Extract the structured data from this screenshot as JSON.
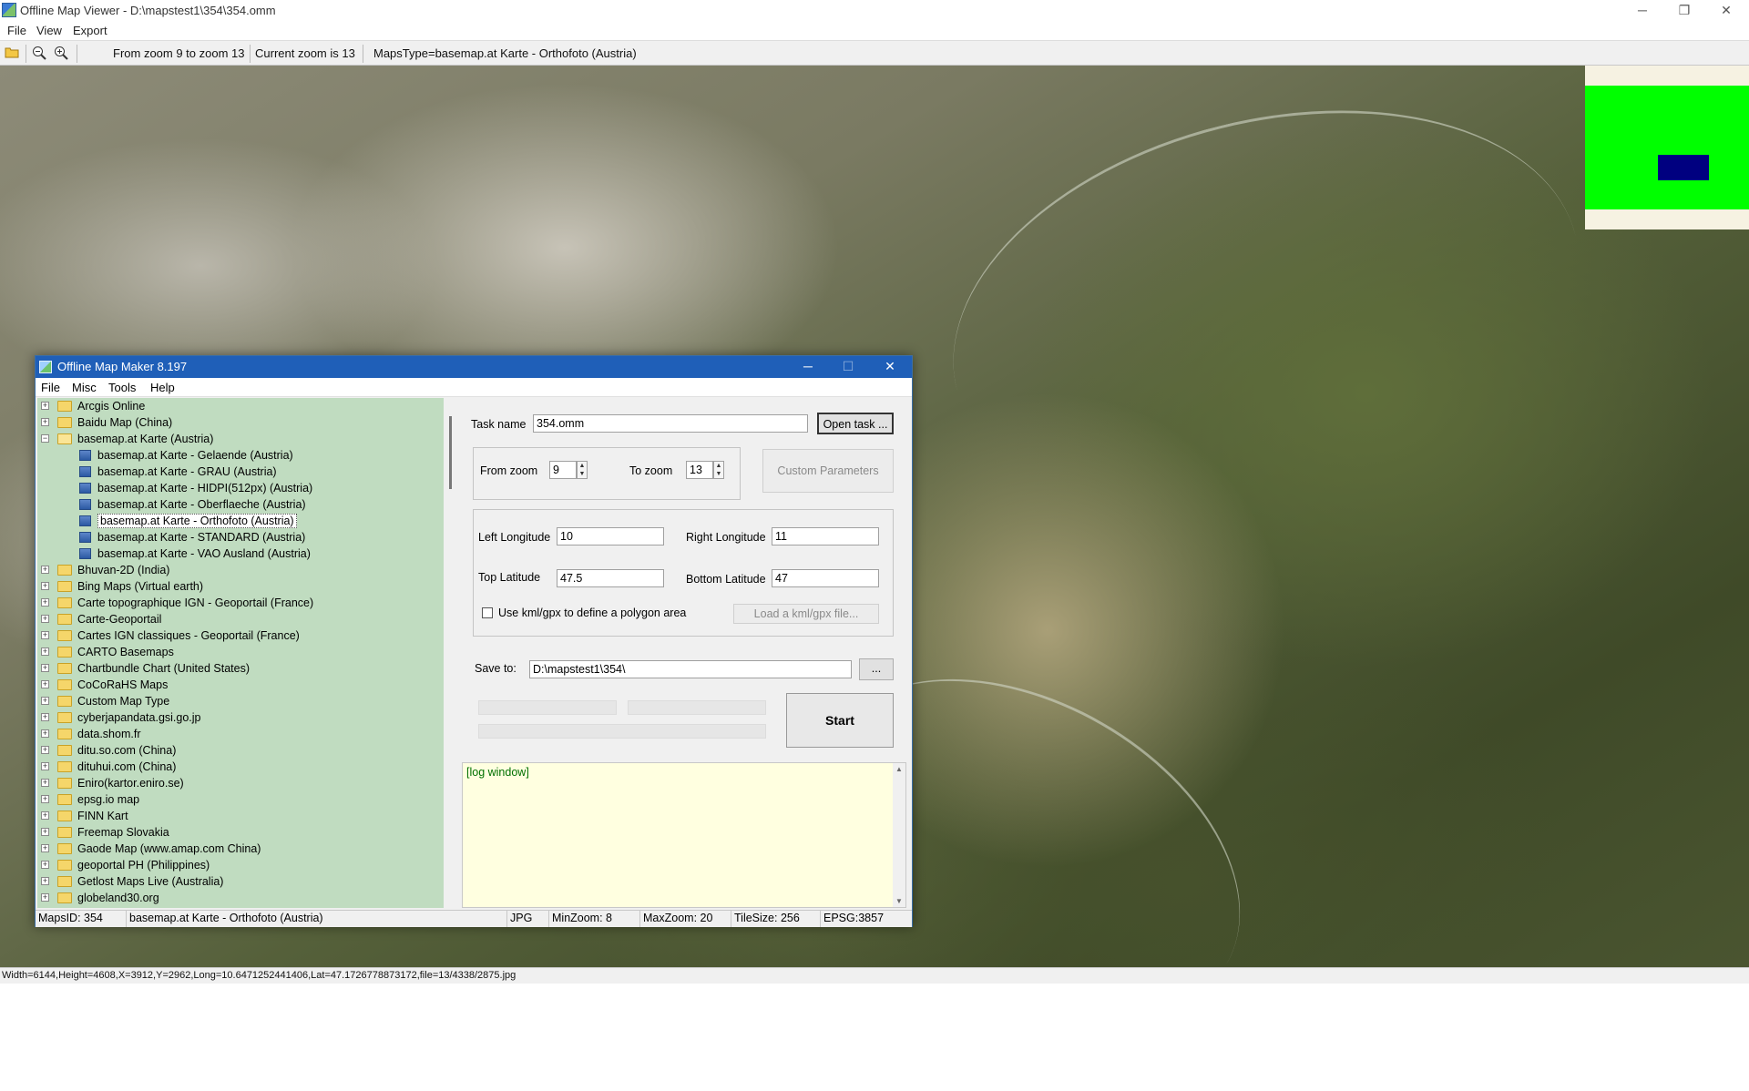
{
  "window": {
    "title": "Offline Map Viewer - D:\\mapstest1\\354\\354.omm",
    "controls": {
      "minimize": "─",
      "maximize": "❐",
      "close": "✕"
    }
  },
  "menu": [
    "File",
    "View",
    "Export"
  ],
  "toolbar": {
    "icons": [
      "open-folder-icon",
      "zoom-out-icon",
      "zoom-in-icon"
    ],
    "zoom_range": "From zoom 9 to zoom 13",
    "current_zoom": "Current zoom is 13",
    "maps_type": "MapsType=basemap.at Karte - Orthofoto (Austria)"
  },
  "status_main": "Width=6144,Height=4608,X=3912,Y=2962,Long=10.6471252441406,Lat=47.1726778873172,file=13/4338/2875.jpg",
  "overview_colors": {
    "background": "#f6f2e2",
    "frame": "#00ff00",
    "viewport": "#000080"
  },
  "dialog": {
    "title": "Offline Map Maker 8.197",
    "controls": {
      "minimize": "─",
      "maximize": "☐",
      "close": "✕"
    },
    "menu": [
      "File",
      "Misc",
      "Tools",
      "Help"
    ],
    "tree": [
      {
        "label": "Arcgis Online",
        "level": 0,
        "expanded": false
      },
      {
        "label": "Baidu Map (China)",
        "level": 0,
        "expanded": false
      },
      {
        "label": "basemap.at Karte (Austria)",
        "level": 0,
        "expanded": true
      },
      {
        "label": "basemap.at Karte - Gelaende (Austria)",
        "level": 1
      },
      {
        "label": "basemap.at Karte - GRAU (Austria)",
        "level": 1
      },
      {
        "label": "basemap.at Karte - HIDPI(512px) (Austria)",
        "level": 1
      },
      {
        "label": "basemap.at Karte - Oberflaeche (Austria)",
        "level": 1
      },
      {
        "label": "basemap.at Karte - Orthofoto (Austria)",
        "level": 1,
        "selected": true
      },
      {
        "label": "basemap.at Karte - STANDARD (Austria)",
        "level": 1
      },
      {
        "label": "basemap.at Karte - VAO Ausland (Austria)",
        "level": 1
      },
      {
        "label": "Bhuvan-2D (India)",
        "level": 0,
        "expanded": false
      },
      {
        "label": "Bing Maps (Virtual earth)",
        "level": 0,
        "expanded": false
      },
      {
        "label": "Carte topographique IGN - Geoportail (France)",
        "level": 0,
        "expanded": false
      },
      {
        "label": "Carte-Geoportail",
        "level": 0,
        "expanded": false
      },
      {
        "label": "Cartes IGN classiques - Geoportail (France)",
        "level": 0,
        "expanded": false
      },
      {
        "label": "CARTO Basemaps",
        "level": 0,
        "expanded": false
      },
      {
        "label": "Chartbundle Chart (United States)",
        "level": 0,
        "expanded": false
      },
      {
        "label": "CoCoRaHS Maps",
        "level": 0,
        "expanded": false
      },
      {
        "label": "Custom Map Type",
        "level": 0,
        "expanded": false
      },
      {
        "label": "cyberjapandata.gsi.go.jp",
        "level": 0,
        "expanded": false
      },
      {
        "label": "data.shom.fr",
        "level": 0,
        "expanded": false
      },
      {
        "label": "ditu.so.com (China)",
        "level": 0,
        "expanded": false
      },
      {
        "label": "dituhui.com (China)",
        "level": 0,
        "expanded": false
      },
      {
        "label": "Eniro(kartor.eniro.se)",
        "level": 0,
        "expanded": false
      },
      {
        "label": "epsg.io map",
        "level": 0,
        "expanded": false
      },
      {
        "label": "FINN Kart",
        "level": 0,
        "expanded": false
      },
      {
        "label": "Freemap Slovakia",
        "level": 0,
        "expanded": false
      },
      {
        "label": "Gaode Map (www.amap.com China)",
        "level": 0,
        "expanded": false
      },
      {
        "label": "geoportal PH (Philippines)",
        "level": 0,
        "expanded": false
      },
      {
        "label": "Getlost Maps Live (Australia)",
        "level": 0,
        "expanded": false
      },
      {
        "label": "globeland30.org",
        "level": 0,
        "expanded": false
      }
    ],
    "task": {
      "label": "Task name",
      "value": "354.omm",
      "open_button": "Open task ..."
    },
    "zoom": {
      "from_label": "From zoom",
      "from_value": "9",
      "to_label": "To zoom",
      "to_value": "13",
      "custom_button": "Custom Parameters"
    },
    "bounds": {
      "left_label": "Left Longitude",
      "left_value": "10",
      "right_label": "Right Longitude",
      "right_value": "11",
      "top_label": "Top Latitude",
      "top_value": "47.5",
      "bottom_label": "Bottom Latitude",
      "bottom_value": "47",
      "kml_label": "Use kml/gpx to define a polygon area",
      "kml_button": "Load a kml/gpx file..."
    },
    "save": {
      "label": "Save to:",
      "value": "D:\\mapstest1\\354\\",
      "browse_button": "..."
    },
    "start_button": "Start",
    "log_text": "[log window]",
    "status": {
      "maps_id": "MapsID: 354",
      "map_name": "basemap.at Karte - Orthofoto (Austria)",
      "format": "JPG",
      "min_zoom": "MinZoom: 8",
      "max_zoom": "MaxZoom: 20",
      "tile_size": "TileSize: 256",
      "epsg": "EPSG:3857"
    }
  }
}
